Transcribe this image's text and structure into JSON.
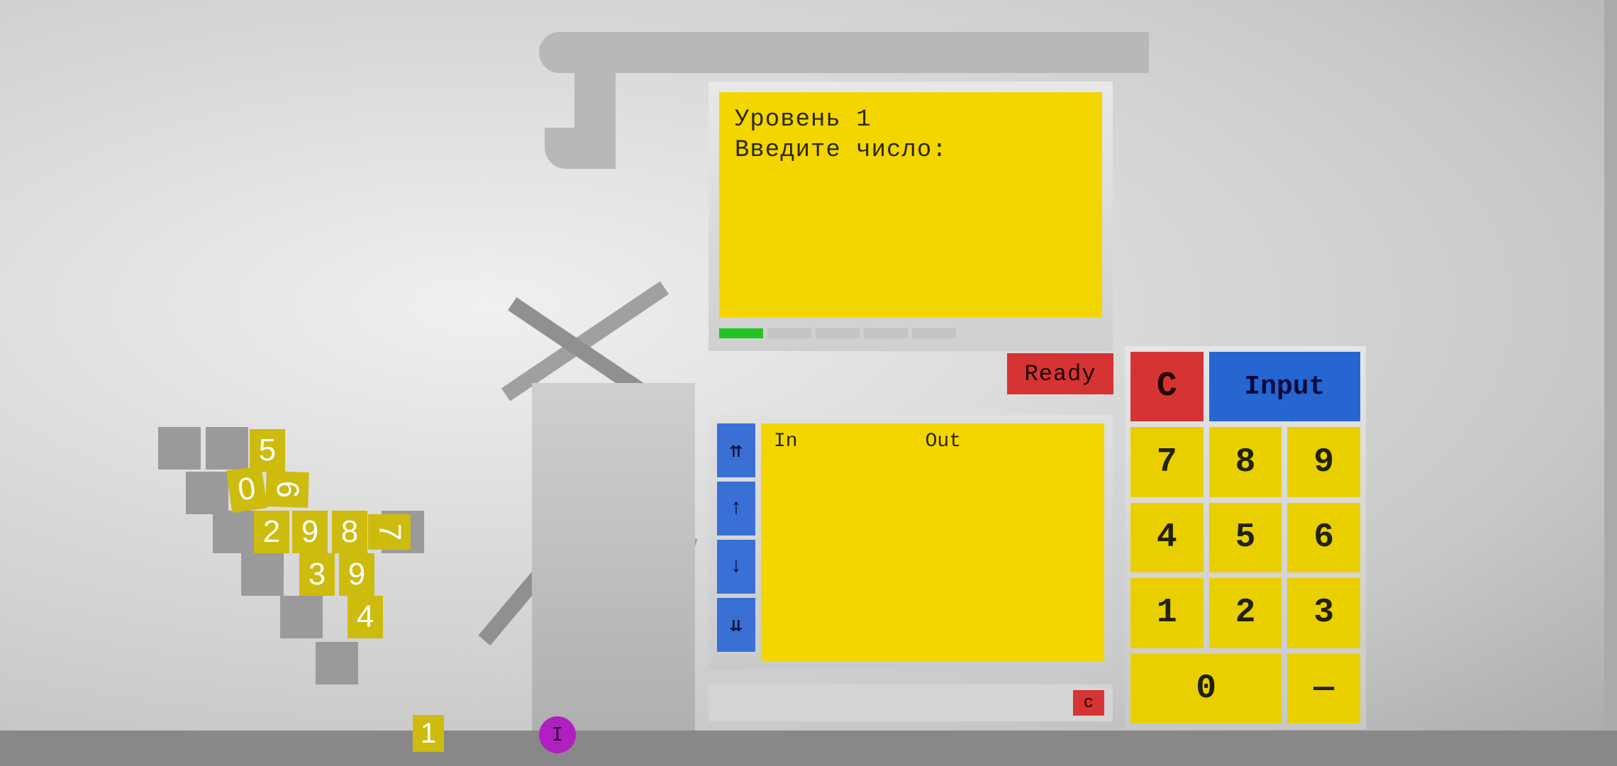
{
  "monitor": {
    "line1": "Уровень 1",
    "line2": "Введите число:"
  },
  "ready_label": "Ready",
  "io": {
    "in_label": "In",
    "out_label": "Out"
  },
  "scroll": {
    "top": "⇈",
    "up": "↑",
    "down": "↓",
    "bottom": "⇊"
  },
  "bottom": {
    "c": "c"
  },
  "keypad": {
    "c": "C",
    "input": "Input",
    "k7": "7",
    "k8": "8",
    "k9": "9",
    "k4": "4",
    "k5": "5",
    "k6": "6",
    "k1": "1",
    "k2": "2",
    "k3": "3",
    "k0": "0",
    "dash": "—"
  },
  "pile": {
    "d5": "5",
    "d0": "0",
    "d6": "6",
    "d2": "2",
    "d9": "9",
    "d8": "8",
    "d7": "7",
    "d3": "3",
    "d9b": "9",
    "d4": "4"
  },
  "floor_tile": "1",
  "player": "I"
}
